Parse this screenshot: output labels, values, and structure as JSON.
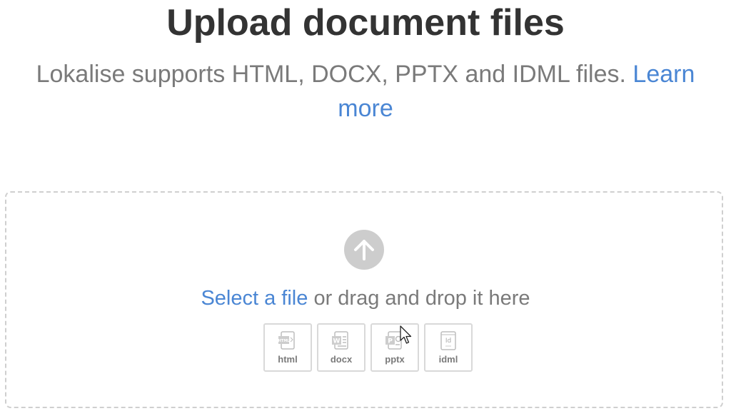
{
  "header": {
    "title": "Upload document files",
    "subtitle": "Lokalise supports HTML, DOCX, PPTX and IDML files.",
    "learn_more": "Learn more"
  },
  "dropzone": {
    "select_link": "Select a file",
    "drag_text": "or drag and drop it here",
    "upload_icon": "arrow-up-circle-icon",
    "file_types": [
      {
        "label": "html",
        "icon": "html-file-icon",
        "glyph": "HTML"
      },
      {
        "label": "docx",
        "icon": "word-file-icon",
        "glyph": "W"
      },
      {
        "label": "pptx",
        "icon": "powerpoint-file-icon",
        "glyph": "P"
      },
      {
        "label": "idml",
        "icon": "indesign-file-icon",
        "glyph": "Id"
      }
    ]
  },
  "colors": {
    "link": "#4a86d4",
    "title": "#333333",
    "muted_text": "#7a7a7a",
    "dashed_border": "#cfcfcf",
    "icon_gray": "#cdcdcd"
  }
}
